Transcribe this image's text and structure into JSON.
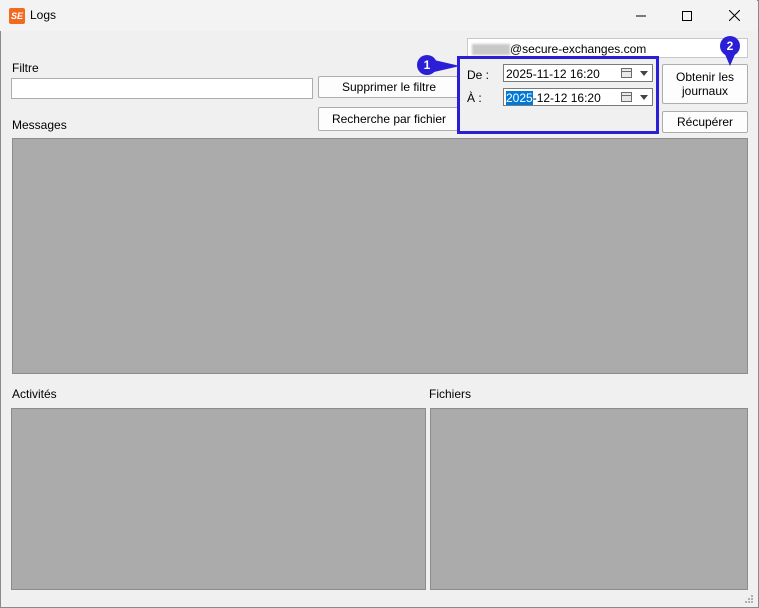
{
  "window": {
    "title": "Logs",
    "app_icon_text": "SE"
  },
  "filter": {
    "label": "Filtre",
    "value": "",
    "clear_button": "Supprimer le filtre",
    "search_file_button": "Recherche par fichier"
  },
  "account": {
    "email_suffix": "@secure-exchanges.com"
  },
  "dates": {
    "from_label": "De :",
    "from_value": "2025-11-12 16:20",
    "to_label": "À :",
    "to_value_selected": "2025",
    "to_value_rest": "-12-12 16:20"
  },
  "actions": {
    "get_logs_button": "Obtenir les journaux",
    "retrieve_button": "Récupérer"
  },
  "sections": {
    "messages": "Messages",
    "activities": "Activités",
    "files": "Fichiers"
  },
  "markers": {
    "one": "1",
    "two": "2"
  },
  "colors": {
    "highlight": "#2a1fd6",
    "panel": "#ababab",
    "selection": "#0078d7"
  }
}
